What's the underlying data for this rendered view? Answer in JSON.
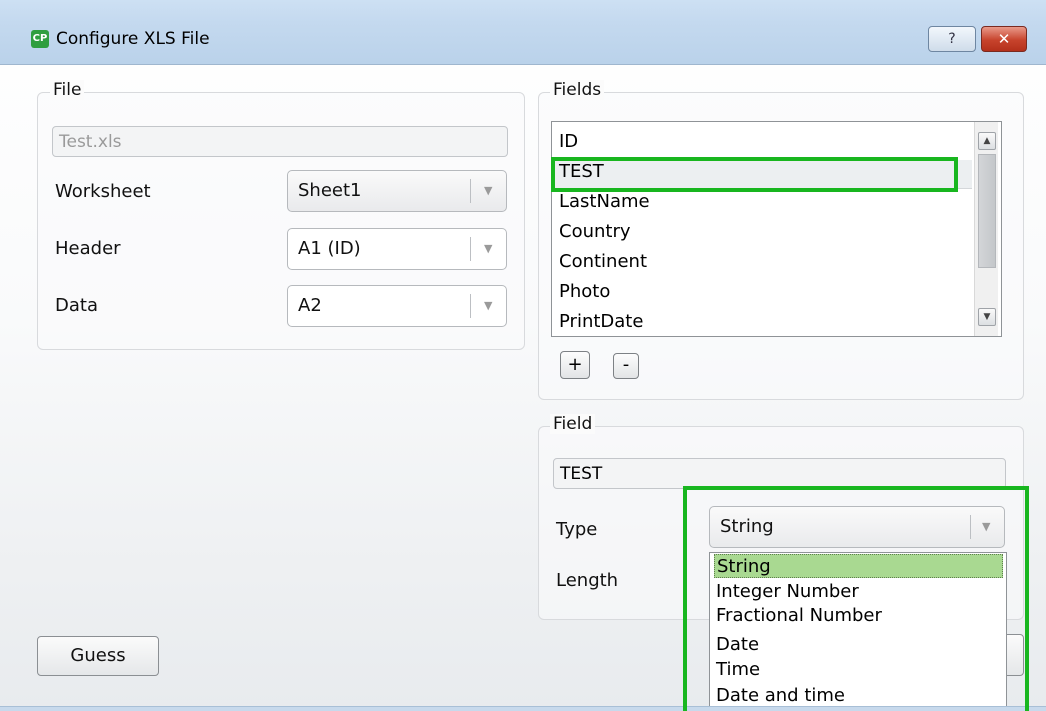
{
  "window": {
    "title": "Configure XLS File",
    "app_icon": "CP",
    "help_label": "?",
    "close_label": "✕"
  },
  "file_group": {
    "title": "File",
    "filename": "Test.xls",
    "worksheet_label": "Worksheet",
    "worksheet_value": "Sheet1",
    "header_label": "Header",
    "header_value": "A1 (ID)",
    "data_label": "Data",
    "data_value": "A2"
  },
  "fields_group": {
    "title": "Fields",
    "items": [
      "ID",
      "TEST",
      "LastName",
      "Country",
      "Continent",
      "Photo",
      "PrintDate"
    ],
    "selected_index": 1,
    "add_label": "+",
    "remove_label": "-"
  },
  "field_group": {
    "title": "Field",
    "name_value": "TEST",
    "type_label": "Type",
    "type_value": "String",
    "length_label": "Length",
    "type_options": [
      "String",
      "Integer Number",
      "Fractional Number",
      "Date",
      "Time",
      "Date and time"
    ]
  },
  "buttons": {
    "guess_label": "Guess"
  },
  "colors": {
    "highlight": "#18b61f",
    "selected_option": "#a9d991",
    "title_bar": "#c4d9ef"
  }
}
